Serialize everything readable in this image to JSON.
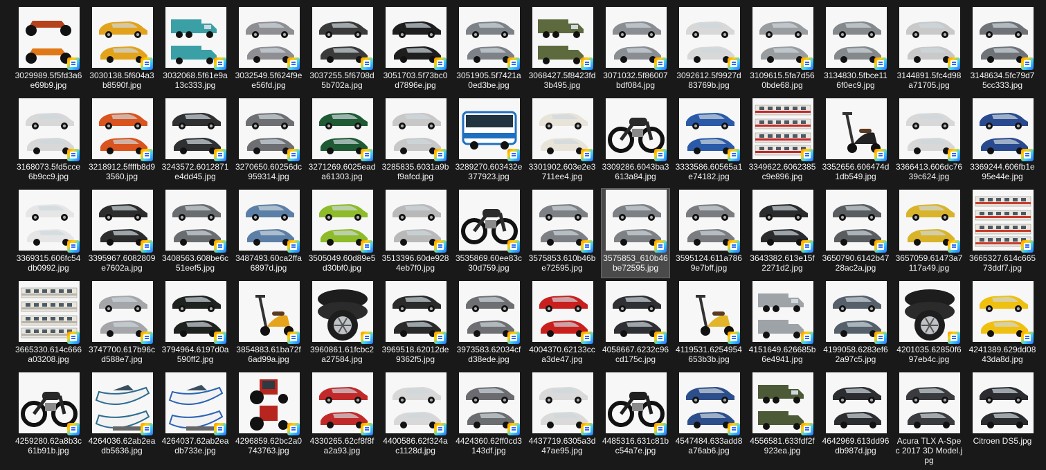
{
  "files": [
    {
      "name": "3029989.5f5fd3a6e69b9.jpg",
      "kind": "quad",
      "color": "#b6431b",
      "icon": "atv-thumbnail"
    },
    {
      "name": "3030138.5f604a3b8590f.jpg",
      "kind": "car",
      "color": "#e3a21c",
      "icon": "car-thumbnail"
    },
    {
      "name": "3032068.5f61e9a13c333.jpg",
      "kind": "truck",
      "color": "#3aa0a6",
      "icon": "pickup-thumbnail"
    },
    {
      "name": "3032549.5f624f9ee56fd.jpg",
      "kind": "car",
      "color": "#8e8e93",
      "icon": "car-thumbnail"
    },
    {
      "name": "3037255.5f6708d5b702a.jpg",
      "kind": "car",
      "color": "#3a3a3a",
      "icon": "car-thumbnail"
    },
    {
      "name": "3051703.5f73bc0d7896e.jpg",
      "kind": "car",
      "color": "#1e1e1e",
      "icon": "car-thumbnail"
    },
    {
      "name": "3051905.5f7421a0ed3be.jpg",
      "kind": "car",
      "color": "#7c8288",
      "icon": "car-thumbnail"
    },
    {
      "name": "3068427.5f8423fd3b495.jpg",
      "kind": "truck",
      "color": "#5d6a3e",
      "icon": "military-truck-thumbnail"
    },
    {
      "name": "3071032.5f86007bdf084.jpg",
      "kind": "car",
      "color": "#8a8e92",
      "icon": "car-thumbnail"
    },
    {
      "name": "3092612.5f9927d83769b.jpg",
      "kind": "car",
      "color": "#d8d8d8",
      "icon": "car-thumbnail"
    },
    {
      "name": "3109615.5fa7d560bde68.jpg",
      "kind": "car",
      "color": "#9a9da0",
      "icon": "car-thumbnail"
    },
    {
      "name": "3134830.5fbce116f0ec9.jpg",
      "kind": "car",
      "color": "#85898c",
      "icon": "car-thumbnail"
    },
    {
      "name": "3144891.5fc4d98a71705.jpg",
      "kind": "car",
      "color": "#c9c9c9",
      "icon": "car-thumbnail"
    },
    {
      "name": "3148634.5fc79d75cc333.jpg",
      "kind": "car",
      "color": "#6f7378",
      "icon": "car-thumbnail"
    },
    {
      "name": "3168073.5fd5cce6b9cc9.jpg",
      "kind": "car",
      "color": "#d8d8d8",
      "icon": "car-thumbnail"
    },
    {
      "name": "3218912.5ffffb8d93560.jpg",
      "kind": "car",
      "color": "#d9541e",
      "icon": "car-thumbnail"
    },
    {
      "name": "3243572.6012871e4dd45.jpg",
      "kind": "car",
      "color": "#2f3032",
      "icon": "car-thumbnail"
    },
    {
      "name": "3270650.60256dc959314.jpg",
      "kind": "car",
      "color": "#6d6f72",
      "icon": "car-thumbnail"
    },
    {
      "name": "3271269.6025eada61303.jpg",
      "kind": "car",
      "color": "#1f5a34",
      "icon": "car-thumbnail"
    },
    {
      "name": "3285835.6031a9bf9afcd.jpg",
      "kind": "car",
      "color": "#c8c8c8",
      "icon": "car-thumbnail"
    },
    {
      "name": "3289270.603432e377923.jpg",
      "kind": "bus",
      "color": "#1f6fc1",
      "icon": "bus-thumbnail"
    },
    {
      "name": "3301902.603e2e3711ee4.jpg",
      "kind": "car",
      "color": "#e8e4da",
      "icon": "car-thumbnail"
    },
    {
      "name": "3309286.6043ba3613a84.jpg",
      "kind": "moto",
      "color": "#2a2a2a",
      "icon": "motorcycle-thumbnail"
    },
    {
      "name": "3333586.60565a1e74182.jpg",
      "kind": "car",
      "color": "#2a5aa8",
      "icon": "car-thumbnail"
    },
    {
      "name": "3349622.6062385c9e896.jpg",
      "kind": "train",
      "color": "#c2282b",
      "icon": "train-thumbnail"
    },
    {
      "name": "3352656.606474d1db549.jpg",
      "kind": "scooter",
      "color": "#222222",
      "icon": "kick-scooter-thumbnail"
    },
    {
      "name": "3366413.606dc7639c624.jpg",
      "kind": "car",
      "color": "#d8d8d8",
      "icon": "car-thumbnail"
    },
    {
      "name": "3369244.606fb1e95e44e.jpg",
      "kind": "car",
      "color": "#294a8f",
      "icon": "car-thumbnail"
    },
    {
      "name": "3369315.606fc54db0992.jpg",
      "kind": "car",
      "color": "#e6e6e6",
      "icon": "car-thumbnail"
    },
    {
      "name": "3395967.6082809e7602a.jpg",
      "kind": "car",
      "color": "#2c2c2c",
      "icon": "car-thumbnail"
    },
    {
      "name": "3408563.608be6c51eef5.jpg",
      "kind": "car",
      "color": "#6a6d70",
      "icon": "car-thumbnail"
    },
    {
      "name": "3487493.60ca2ffa6897d.jpg",
      "kind": "car",
      "color": "#5b7fa6",
      "icon": "car-thumbnail"
    },
    {
      "name": "3505049.60d89e5d30bf0.jpg",
      "kind": "car",
      "color": "#8dbb2a",
      "icon": "car-thumbnail"
    },
    {
      "name": "3513396.60de9284eb7f0.jpg",
      "kind": "car",
      "color": "#b9b9b9",
      "icon": "car-thumbnail"
    },
    {
      "name": "3535869.60ee83c30d759.jpg",
      "kind": "moto",
      "color": "#2b2b2b",
      "icon": "motorcycle-thumbnail"
    },
    {
      "name": "3575853.610b46be72595.jpg",
      "kind": "car",
      "color": "#7d8084",
      "icon": "car-thumbnail"
    },
    {
      "name": "3575853_610b46be72595.jpg",
      "kind": "car",
      "color": "#7d8084",
      "icon": "car-thumbnail",
      "selected": true
    },
    {
      "name": "3595124.611a7869e7bff.jpg",
      "kind": "car",
      "color": "#7a7c80",
      "icon": "car-thumbnail"
    },
    {
      "name": "3643382.613e15f2271d2.jpg",
      "kind": "car",
      "color": "#2a2b2d",
      "icon": "car-thumbnail"
    },
    {
      "name": "3650790.6142b4728ac2a.jpg",
      "kind": "car",
      "color": "#5a5d60",
      "icon": "car-thumbnail"
    },
    {
      "name": "3657059.61473a7117a49.jpg",
      "kind": "car",
      "color": "#d9b42a",
      "icon": "car-thumbnail"
    },
    {
      "name": "3665327.614c66573ddf7.jpg",
      "kind": "train",
      "color": "#c83b2c",
      "icon": "train-thumbnail"
    },
    {
      "name": "3665330.614c666a03208.jpg",
      "kind": "train",
      "color": "#b8b3a8",
      "icon": "train-thumbnail"
    },
    {
      "name": "3747700.617b96cd588e7.jpg",
      "kind": "car",
      "color": "#a4a6a9",
      "icon": "car-thumbnail"
    },
    {
      "name": "3794964.6197d0a590ff2.jpg",
      "kind": "car",
      "color": "#1f2320",
      "icon": "car-thumbnail"
    },
    {
      "name": "3854883.61ba72f6ad99a.jpg",
      "kind": "scooter",
      "color": "#e6a41c",
      "icon": "vespa-thumbnail"
    },
    {
      "name": "3960861.61fcbc2a27584.jpg",
      "kind": "tires",
      "color": "#1d1d1d",
      "icon": "tires-thumbnail"
    },
    {
      "name": "3969518.62012de9362f5.jpg",
      "kind": "car",
      "color": "#2a2a2a",
      "icon": "car-thumbnail"
    },
    {
      "name": "3973583.62034cfd38ede.jpg",
      "kind": "car",
      "color": "#6e6f72",
      "icon": "car-thumbnail"
    },
    {
      "name": "4004370.62133cca3de47.jpg",
      "kind": "car",
      "color": "#c9201e",
      "icon": "car-thumbnail"
    },
    {
      "name": "4058667.6232c96cd175c.jpg",
      "kind": "car",
      "color": "#2f3033",
      "icon": "car-thumbnail"
    },
    {
      "name": "4119531.6254954653b3b.jpg",
      "kind": "scooter",
      "color": "#e3b52a",
      "icon": "vespa-thumbnail"
    },
    {
      "name": "4151649.626685b6e4941.jpg",
      "kind": "truck",
      "color": "#9ea3a8",
      "icon": "van-thumbnail"
    },
    {
      "name": "4199058.6283ef62a97c5.jpg",
      "kind": "car",
      "color": "#55606b",
      "icon": "car-thumbnail"
    },
    {
      "name": "4201035.62850f697eb4c.jpg",
      "kind": "tires",
      "color": "#1d1d1d",
      "icon": "tires-thumbnail"
    },
    {
      "name": "4241389.629dd0843da8d.jpg",
      "kind": "car",
      "color": "#f0c010",
      "icon": "car-thumbnail"
    },
    {
      "name": "4259280.62a8b3c61b91b.jpg",
      "kind": "moto",
      "color": "#272727",
      "icon": "motorcycle-thumbnail"
    },
    {
      "name": "4264036.62ab2eadb5636.jpg",
      "kind": "boat",
      "color": "#2c6d8e",
      "icon": "boat-thumbnail"
    },
    {
      "name": "4264037.62ab2eadb733e.jpg",
      "kind": "boat",
      "color": "#2a64b5",
      "icon": "boat-thumbnail"
    },
    {
      "name": "4296859.62bc2a0743763.jpg",
      "kind": "tractor",
      "color": "#b7261e",
      "icon": "tractor-thumbnail"
    },
    {
      "name": "4330265.62cf8f8fa2a93.jpg",
      "kind": "car",
      "color": "#c22a2a",
      "icon": "car-thumbnail"
    },
    {
      "name": "4400586.62f324ac1128d.jpg",
      "kind": "car",
      "color": "#d8d8d8",
      "icon": "car-thumbnail"
    },
    {
      "name": "4424360.62ff0cd3143df.jpg",
      "kind": "car",
      "color": "#6a6c70",
      "icon": "car-thumbnail"
    },
    {
      "name": "4437719.6305a3d47ae95.jpg",
      "kind": "car",
      "color": "#dadada",
      "icon": "car-thumbnail"
    },
    {
      "name": "4485316.631c81bc54a7e.jpg",
      "kind": "moto",
      "color": "#1f1f1f",
      "icon": "motorcycle-thumbnail"
    },
    {
      "name": "4547484.633add8a76ab6.jpg",
      "kind": "car",
      "color": "#2c4f8c",
      "icon": "car-thumbnail"
    },
    {
      "name": "4556581.633fdf2f923ea.jpg",
      "kind": "truck",
      "color": "#4d5a37",
      "icon": "military-truck-thumbnail"
    },
    {
      "name": "4642969.613dd96db987d.jpg",
      "kind": "car",
      "color": "#2c2d30",
      "icon": "car-thumbnail",
      "nobadge": true
    },
    {
      "name": "Acura TLX A-Spec 2017 3D Model.jpg",
      "kind": "car",
      "color": "#3a3b3e",
      "icon": "car-thumbnail",
      "nobadge": true
    },
    {
      "name": "Citroen DS5.jpg",
      "kind": "car",
      "color": "#2a2c30",
      "icon": "car-thumbnail",
      "nobadge": true
    }
  ]
}
